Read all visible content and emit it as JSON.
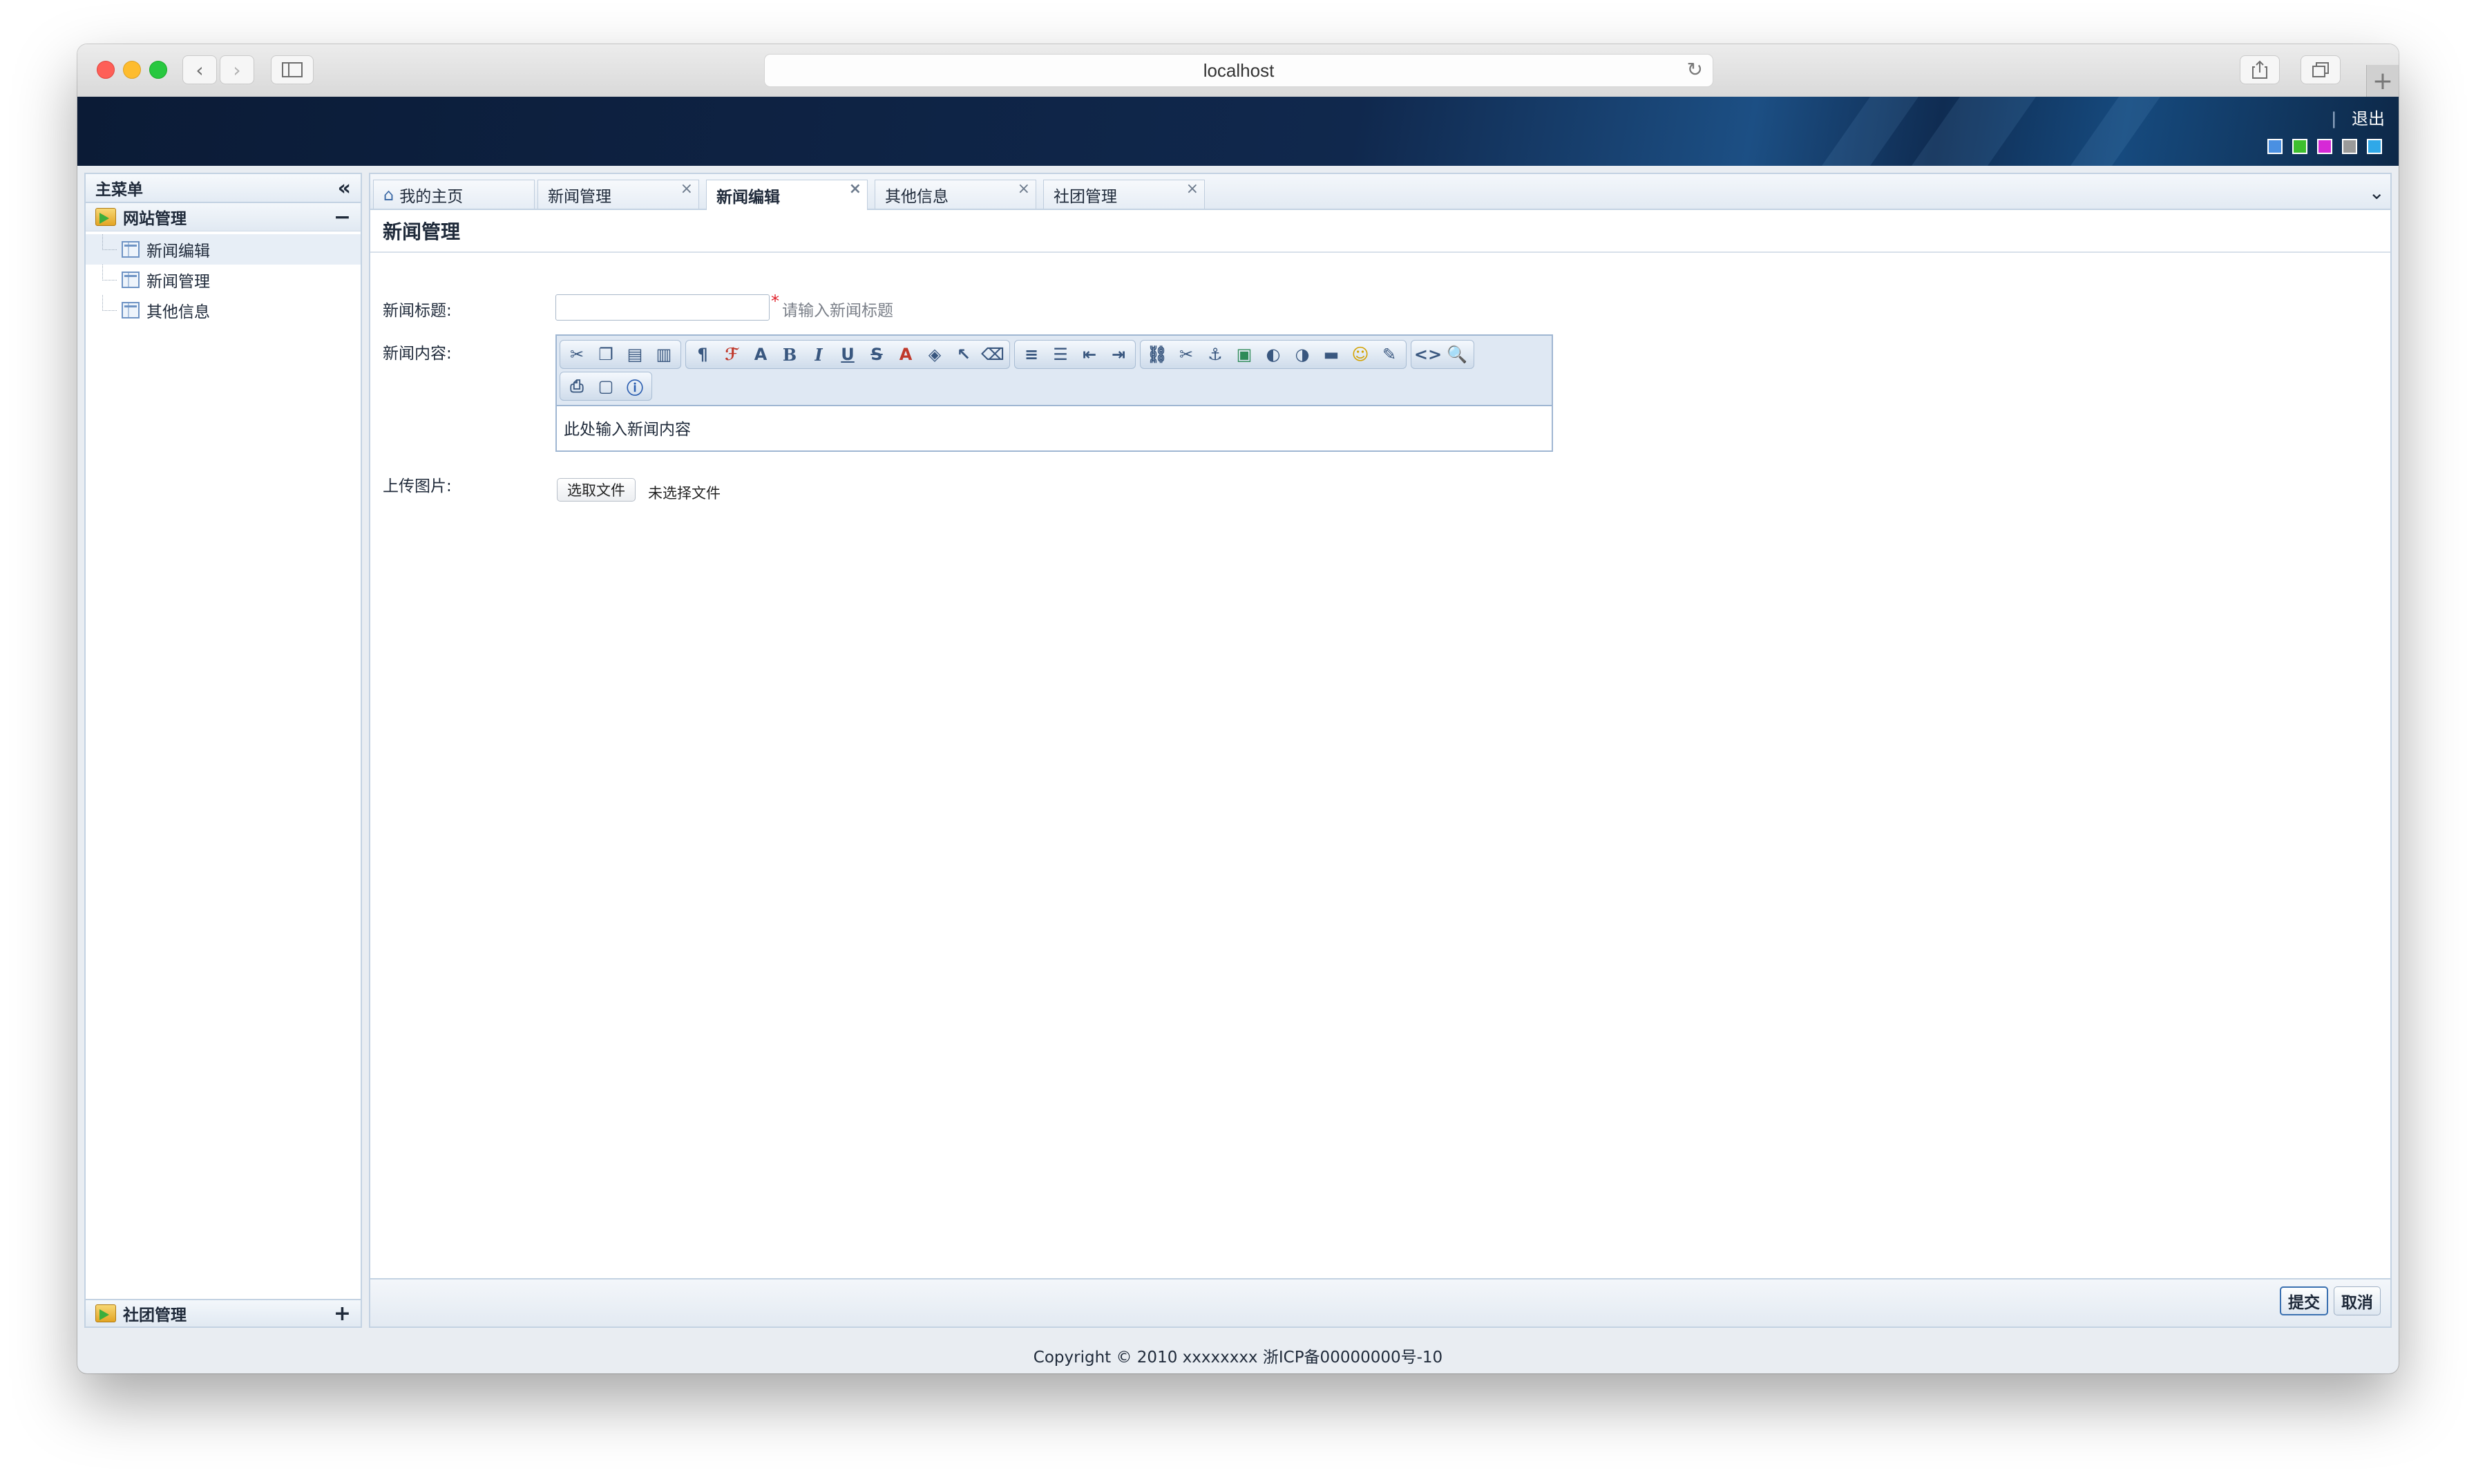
{
  "browser": {
    "url": "localhost"
  },
  "header": {
    "logout_label": "退出",
    "theme_colors": [
      "#4a90e2",
      "#3dbf2e",
      "#d629d6",
      "#9a9a9a",
      "#2fa8e8"
    ]
  },
  "sidebar": {
    "title": "主菜单",
    "groups": [
      {
        "label": "网站管理",
        "expanded": true,
        "items": [
          {
            "label": "新闻编辑",
            "active": true
          },
          {
            "label": "新闻管理",
            "active": false
          },
          {
            "label": "其他信息",
            "active": false
          }
        ]
      },
      {
        "label": "社团管理",
        "expanded": false
      }
    ]
  },
  "tabs": [
    {
      "label": "我的主页",
      "closable": false,
      "active": false
    },
    {
      "label": "新闻管理",
      "closable": true,
      "active": false
    },
    {
      "label": "新闻编辑",
      "closable": true,
      "active": true
    },
    {
      "label": "其他信息",
      "closable": true,
      "active": false
    },
    {
      "label": "社团管理",
      "closable": true,
      "active": false
    }
  ],
  "page": {
    "title": "新闻管理",
    "form": {
      "title_label": "新闻标题:",
      "title_value": "",
      "title_required_mark": "*",
      "title_hint": "请输入新闻标题",
      "content_label": "新闻内容:",
      "content_value": "此处输入新闻内容",
      "upload_label": "上传图片:",
      "choose_file_button": "选取文件",
      "file_status": "未选择文件"
    },
    "submit_label": "提交",
    "cancel_label": "取消"
  },
  "footer": {
    "copyright": "Copyright © 2010 xxxxxxxx 浙ICP备00000000号-10"
  }
}
